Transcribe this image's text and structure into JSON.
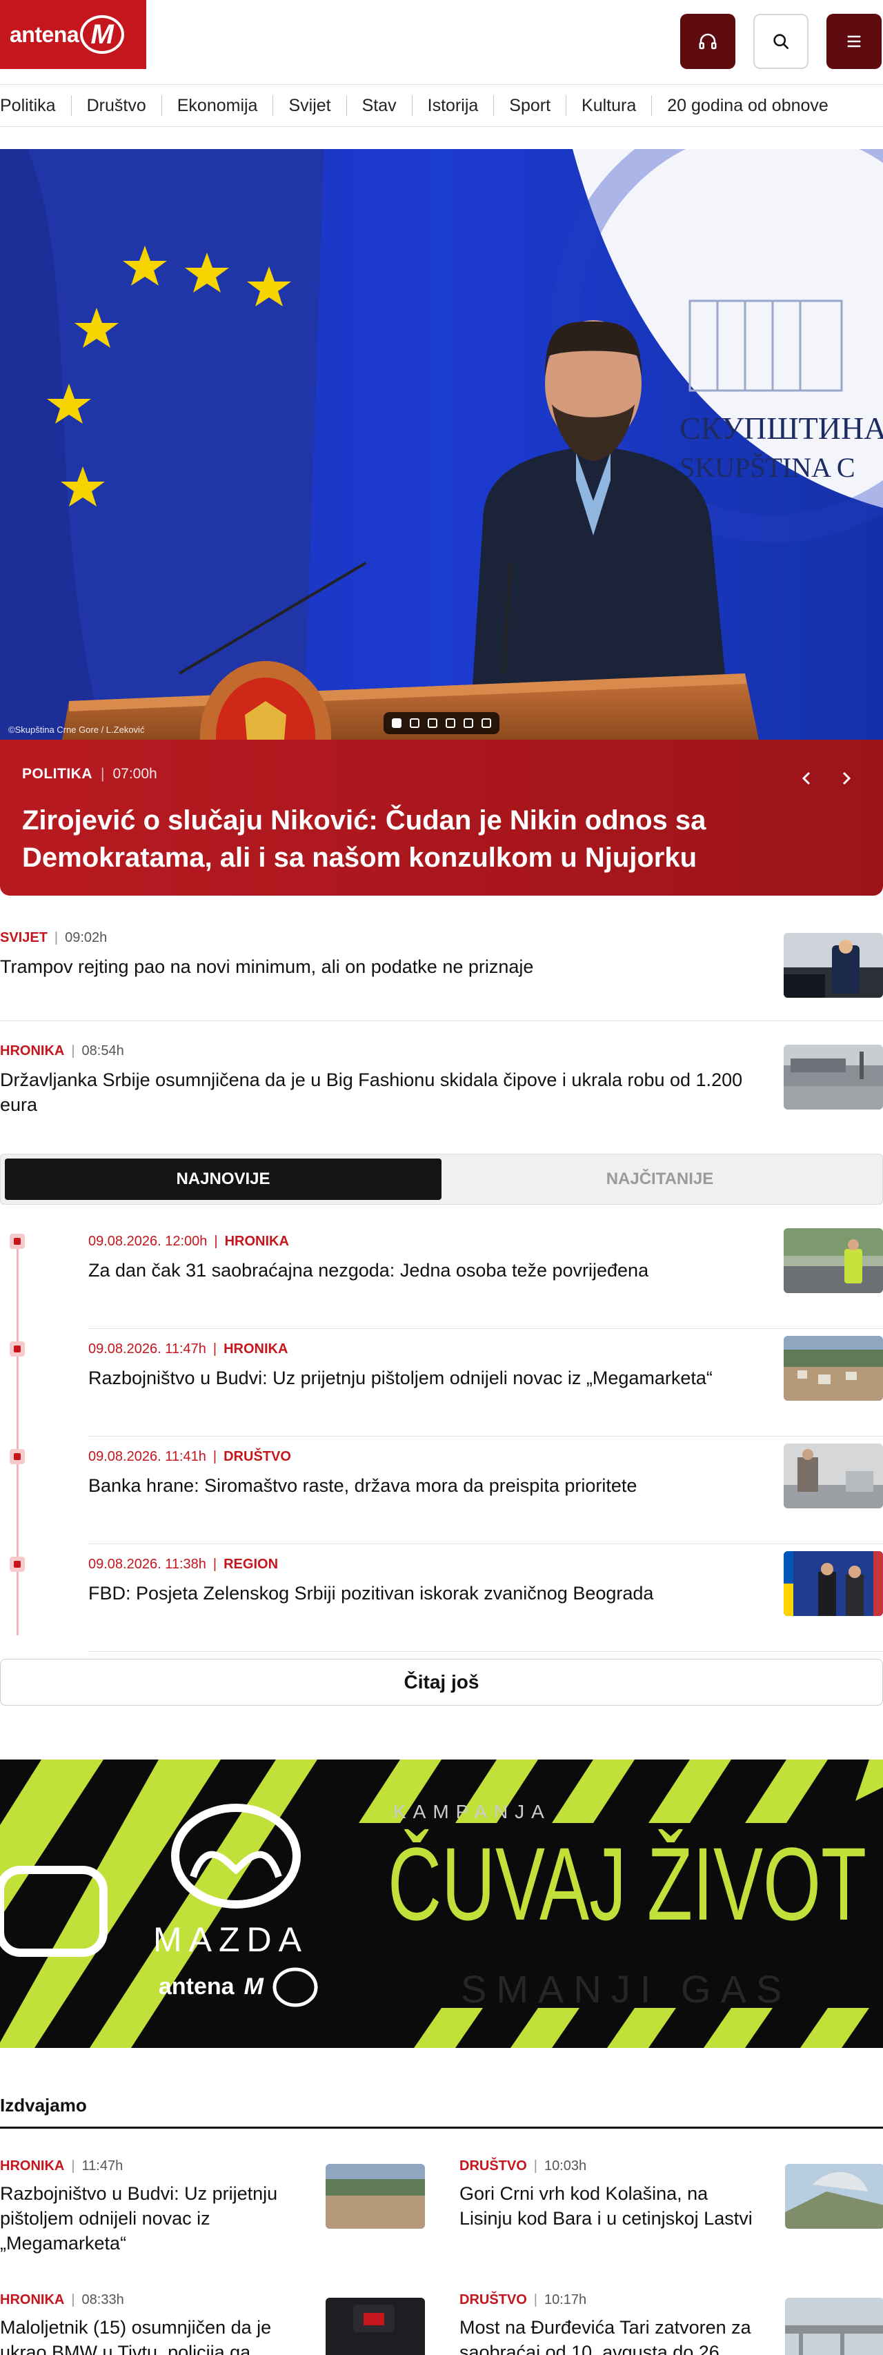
{
  "header": {
    "logo_text": "antena",
    "logo_mark": "M",
    "audio_icon": "headphones-icon",
    "search_icon": "search-icon",
    "menu_icon": "hamburger-menu-icon"
  },
  "nav": {
    "items": [
      "Politika",
      "Društvo",
      "Ekonomija",
      "Svijet",
      "Stav",
      "Istorija",
      "Sport",
      "Kultura",
      "20 godina od obnove"
    ]
  },
  "hero": {
    "credit": "©Skupština Crne Gore / L.Zeković",
    "category": "POLITIKA",
    "time": "07:00h",
    "title": "Zirojević o slučaju Niković: Čudan je Nikin odnos sa Demokratama, ali i sa našom konzulkom u Njujorku",
    "slides": 6,
    "active_slide": 1
  },
  "featured": [
    {
      "category": "SVIJET",
      "time": "09:02h",
      "title": "Trampov rejting pao na novi minimum, ali on podatke ne priznaje"
    },
    {
      "category": "HRONIKA",
      "time": "08:54h",
      "title": "Državljanka Srbije osumnjičena da je u Big Fashionu skidala čipove i ukrala robu od 1.200 eura"
    }
  ],
  "tabs": {
    "latest": "NAJNOVIJE",
    "most_read": "NAJČITANIJE"
  },
  "timeline": [
    {
      "date": "09.08.2026. 12:00h",
      "category": "HRONIKA",
      "title": "Za dan čak 31 saobraćajna nezgoda: Jedna osoba teže povrijeđena"
    },
    {
      "date": "09.08.2026. 11:47h",
      "category": "HRONIKA",
      "title": "Razbojništvo u Budvi: Uz prijetnju pištoljem odnijeli novac iz „Megamarketa“"
    },
    {
      "date": "09.08.2026. 11:41h",
      "category": "DRUŠTVO",
      "title": "Banka hrane: Siromaštvo raste, država mora da preispita prioritete"
    },
    {
      "date": "09.08.2026. 11:38h",
      "category": "REGION",
      "title": "FBD: Posjeta Zelenskog Srbiji pozitivan iskorak zvaničnog Beograda"
    }
  ],
  "more_label": "Čitaj još",
  "banner": {
    "brand": "MAZDA",
    "kicker": "KAMPANJA",
    "headline": "ČUVAJ ŽIVOT",
    "sub": "SMANJI GAS",
    "partner": "antena",
    "partner_mark": "M"
  },
  "section": {
    "title": "Izdvajamo",
    "cards": [
      {
        "category": "HRONIKA",
        "time": "11:47h",
        "title": "Razbojništvo u Budvi: Uz prijetnju pištoljem odnijeli novac iz „Megamarketa“"
      },
      {
        "category": "DRUŠTVO",
        "time": "10:03h",
        "title": "Gori Crni vrh kod Kolašina, na Lisinju kod Bara i u cetinjskoj Lastvi"
      },
      {
        "category": "HRONIKA",
        "time": "08:33h",
        "title": "Maloljetnik (15) osumnjičen da je ukrao BMW u Tivtu, policija ga"
      },
      {
        "category": "DRUŠTVO",
        "time": "10:17h",
        "title": "Most na Đurđevića Tari zatvoren za saobraćaj od 10. avgusta do 26."
      }
    ]
  },
  "colors": {
    "brand": "#c4161c",
    "dark_red": "#5e0b10",
    "lime": "#b8d432"
  }
}
